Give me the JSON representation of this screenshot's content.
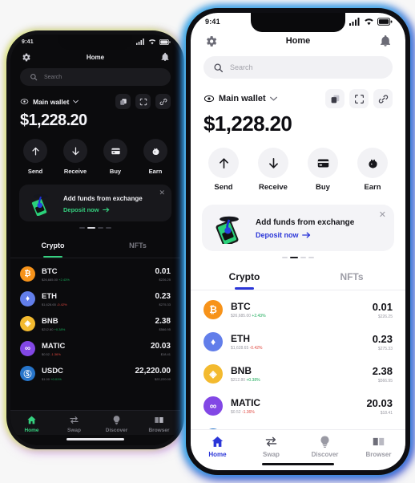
{
  "status_bar": {
    "time": "9:41"
  },
  "header": {
    "title": "Home",
    "settings_icon": "gear-icon",
    "notification_icon": "bell-icon"
  },
  "search": {
    "placeholder": "Search",
    "icon": "search-icon"
  },
  "wallet": {
    "name": "Main wallet",
    "eye_icon": "eye-icon",
    "chevron_icon": "chevron-down-icon",
    "balance": "$1,228.20",
    "actions": [
      {
        "name": "copy-address-button",
        "icon": "copy-icon"
      },
      {
        "name": "scan-qr-button",
        "icon": "scan-icon"
      },
      {
        "name": "connect-button",
        "icon": "link-icon"
      }
    ]
  },
  "quick_actions": [
    {
      "label": "Send",
      "icon": "arrow-up-icon"
    },
    {
      "label": "Receive",
      "icon": "arrow-down-icon"
    },
    {
      "label": "Buy",
      "icon": "card-icon"
    },
    {
      "label": "Earn",
      "icon": "piggy-bank-icon"
    }
  ],
  "banner": {
    "title": "Add funds from exchange",
    "cta": "Deposit now",
    "cta_arrow": "arrow-right-icon",
    "close_icon": "close-icon",
    "art": "phone-deposit-illustration",
    "dots": [
      false,
      true,
      false,
      false
    ]
  },
  "tabs": [
    {
      "label": "Crypto",
      "active": true
    },
    {
      "label": "NFTs",
      "active": false
    }
  ],
  "assets": [
    {
      "symbol": "BTC",
      "price": "$26,685.00",
      "change": "+2.43%",
      "direction": "up",
      "amount": "0.01",
      "fiat": "$226.25",
      "color": "#F7931A",
      "glyph": "₿"
    },
    {
      "symbol": "ETH",
      "price": "$1,628.65",
      "change": "-0.42%",
      "direction": "down",
      "amount": "0.23",
      "fiat": "$275.33",
      "color": "#627EEA",
      "glyph": "Ξ"
    },
    {
      "symbol": "BNB",
      "price": "$212.80",
      "change": "+0.38%",
      "direction": "up",
      "amount": "2.38",
      "fiat": "$566.95",
      "color": "#F3BA2F",
      "glyph": "◈"
    },
    {
      "symbol": "MATIC",
      "price": "$0.52",
      "change": "-1.36%",
      "direction": "down",
      "amount": "20.03",
      "fiat": "$18.41",
      "color": "#8247E5",
      "glyph": "∞"
    },
    {
      "symbol": "USDC",
      "price": "$1.00",
      "change": "+0.01%",
      "direction": "up",
      "amount": "22,220.00",
      "fiat": "$22,220.00",
      "color": "#2775CA",
      "glyph": "Ⓢ"
    }
  ],
  "bottom_nav": [
    {
      "label": "Home",
      "icon": "home-icon",
      "active": true
    },
    {
      "label": "Swap",
      "icon": "swap-icon",
      "active": false
    },
    {
      "label": "Discover",
      "icon": "compass-icon",
      "active": false
    },
    {
      "label": "Browser",
      "icon": "browser-icon",
      "active": false
    }
  ],
  "theme": {
    "light_accent": "#2b36d8",
    "dark_accent": "#35d07f",
    "light_bg": "#ffffff",
    "dark_bg": "#0b0b0d"
  }
}
